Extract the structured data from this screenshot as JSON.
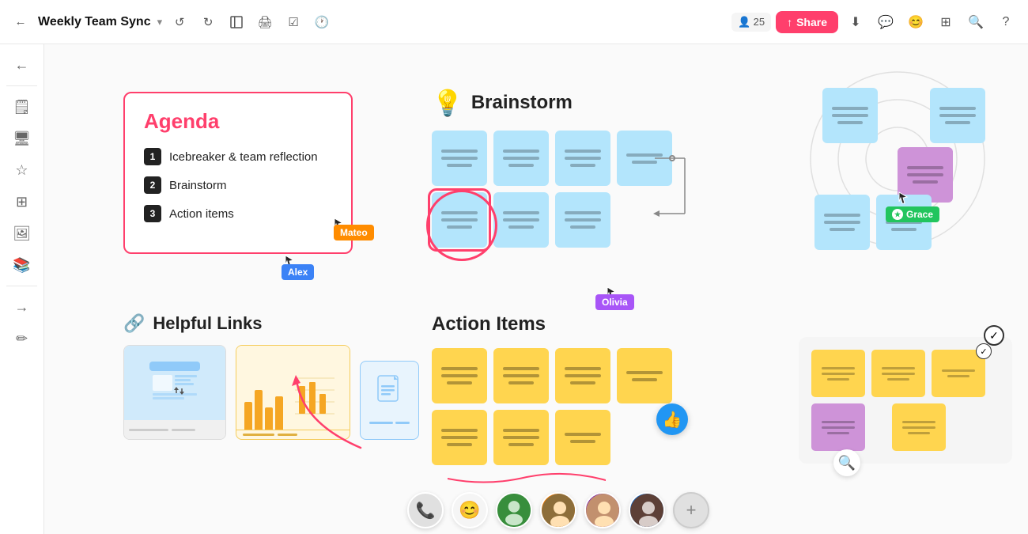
{
  "topbar": {
    "title": "Weekly Team Sync",
    "title_caret": "▾",
    "users_count": "25",
    "share_label": "Share",
    "share_icon": "↑"
  },
  "sidebar": {
    "icons": [
      "←",
      "💬",
      "🖥",
      "★",
      "⊞",
      "🖼",
      "📚",
      "→",
      "✏"
    ]
  },
  "agenda": {
    "title": "Agenda",
    "items": [
      {
        "num": "1",
        "label": "Icebreaker & team reflection"
      },
      {
        "num": "2",
        "label": "Brainstorm"
      },
      {
        "num": "3",
        "label": "Action items"
      }
    ]
  },
  "brainstorm": {
    "title": "Brainstorm",
    "icon": "💡"
  },
  "helpful_links": {
    "title": "Helpful Links",
    "icon": "🔗"
  },
  "action_items": {
    "title": "Action Items"
  },
  "cursors": {
    "mateo": "Mateo",
    "alex": "Alex",
    "olivia": "Olivia",
    "grace": "Grace"
  },
  "bottombar": {
    "phone_icon": "📞",
    "emoji_icon": "😊",
    "add_label": "+"
  }
}
